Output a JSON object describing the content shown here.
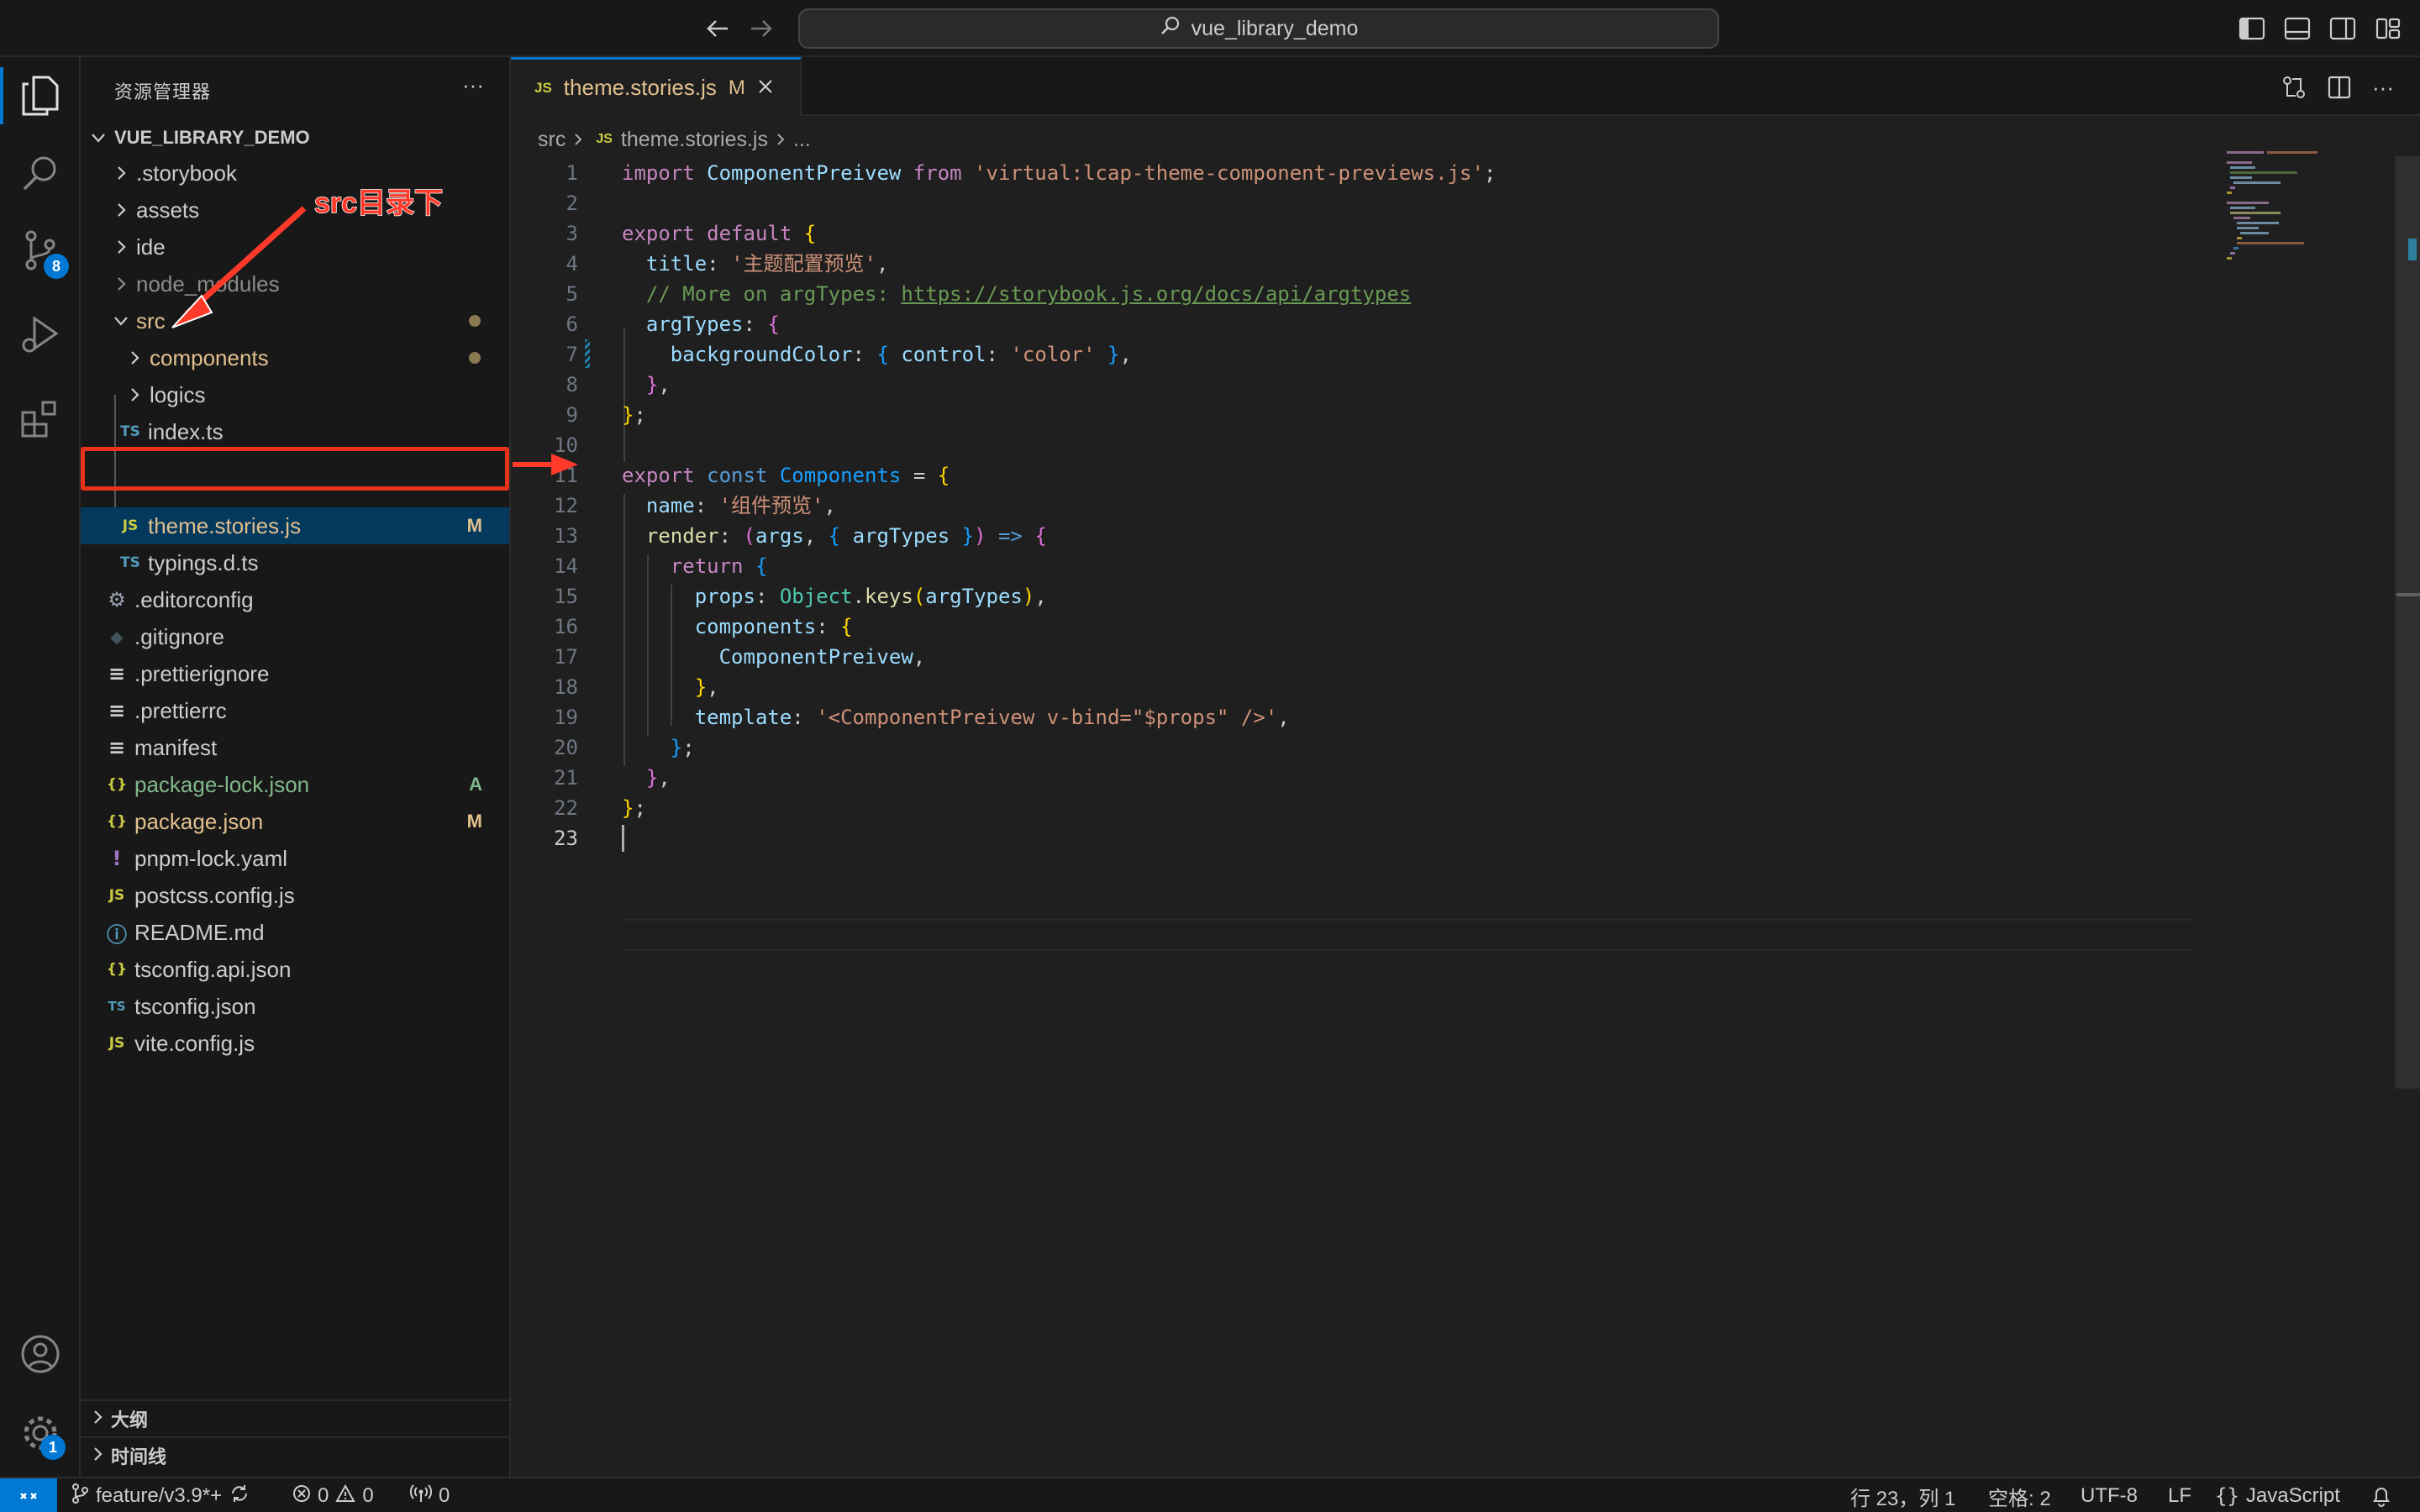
{
  "window": {
    "search_text": "vue_library_demo"
  },
  "activity_bar": {
    "scm_badge": "8",
    "settings_badge": "1"
  },
  "sidebar": {
    "title": "资源管理器",
    "more": "···",
    "root_folder": "VUE_LIBRARY_DEMO",
    "items": [
      {
        "label": ".storybook",
        "icon": "",
        "status": ""
      },
      {
        "label": "assets",
        "icon": "",
        "status": ""
      },
      {
        "label": "ide",
        "icon": "",
        "status": ""
      },
      {
        "label": "node_modules",
        "icon": "",
        "status": ""
      },
      {
        "label": "src",
        "icon": "",
        "status": ""
      },
      {
        "label": "components",
        "icon": "",
        "status": ""
      },
      {
        "label": "logics",
        "icon": "",
        "status": ""
      },
      {
        "label": "index.ts",
        "icon": "TS",
        "status": ""
      },
      {
        "label": "theme.stories.js",
        "icon": "JS",
        "status": "M"
      },
      {
        "label": "typings.d.ts",
        "icon": "TS",
        "status": ""
      },
      {
        "label": ".editorconfig",
        "icon": "⚙",
        "status": ""
      },
      {
        "label": ".gitignore",
        "icon": "◆",
        "status": ""
      },
      {
        "label": ".prettierignore",
        "icon": "≡",
        "status": ""
      },
      {
        "label": ".prettierrc",
        "icon": "≡",
        "status": ""
      },
      {
        "label": "manifest",
        "icon": "≡",
        "status": ""
      },
      {
        "label": "package-lock.json",
        "icon": "{}",
        "status": "A"
      },
      {
        "label": "package.json",
        "icon": "{}",
        "status": "M"
      },
      {
        "label": "pnpm-lock.yaml",
        "icon": "!",
        "status": ""
      },
      {
        "label": "postcss.config.js",
        "icon": "JS",
        "status": ""
      },
      {
        "label": "README.md",
        "icon": "ⓘ",
        "status": ""
      },
      {
        "label": "tsconfig.api.json",
        "icon": "{}",
        "status": ""
      },
      {
        "label": "tsconfig.json",
        "icon": "TS",
        "status": ""
      },
      {
        "label": "vite.config.js",
        "icon": "JS",
        "status": ""
      }
    ],
    "outline": "大纲",
    "timeline": "时间线"
  },
  "annotation": {
    "text": "src目录下"
  },
  "editor": {
    "tab": {
      "icon": "JS",
      "label": "theme.stories.js",
      "status": "M"
    },
    "breadcrumb": {
      "folder": "src",
      "icon": "JS",
      "file": "theme.stories.js",
      "more": "..."
    },
    "line_numbers": [
      "1",
      "2",
      "3",
      "4",
      "5",
      "6",
      "7",
      "8",
      "9",
      "10",
      "11",
      "12",
      "13",
      "14",
      "15",
      "16",
      "17",
      "18",
      "19",
      "20",
      "21",
      "22",
      "23"
    ],
    "code": {
      "l1_import": "import",
      "l1_name": "ComponentPreivew",
      "l1_from": "from",
      "l1_path": "'virtual:lcap-theme-component-previews.js'",
      "l3_export": "export",
      "l3_default": "default",
      "l4_key": "title",
      "l4_val": "'主题配置预览'",
      "l5_comment": "// More on argTypes: ",
      "l5_url": "https://storybook.js.org/docs/api/argtypes",
      "l6_key": "argTypes",
      "l7_key": "backgroundColor",
      "l7_ctrl": "control",
      "l7_val": "'color'",
      "l11_export": "export",
      "l11_const": "const",
      "l11_name": "Components",
      "l12_key": "name",
      "l12_val": "'组件预览'",
      "l13_key": "render",
      "l13_args": "args",
      "l13_argtypes": "argTypes",
      "l14_return": "return",
      "l15_key": "props",
      "l15_obj": "Object",
      "l15_fn": "keys",
      "l15_arg": "argTypes",
      "l16_key": "components",
      "l17_val": "ComponentPreivew",
      "l19_key": "template",
      "l19_val": "'<ComponentPreivew v-bind=\"$props\" />'"
    }
  },
  "statusbar": {
    "branch": "feature/v3.9*+",
    "errors": "0",
    "warnings": "0",
    "ports": "0",
    "position": "行 23，列 1",
    "spaces": "空格: 2",
    "encoding": "UTF-8",
    "eol": "LF",
    "language": "JavaScript"
  },
  "colors": {
    "accent": "#0078d4",
    "annotation_red": "#e8321a",
    "modified": "#e2c08d",
    "added": "#81b88b"
  }
}
